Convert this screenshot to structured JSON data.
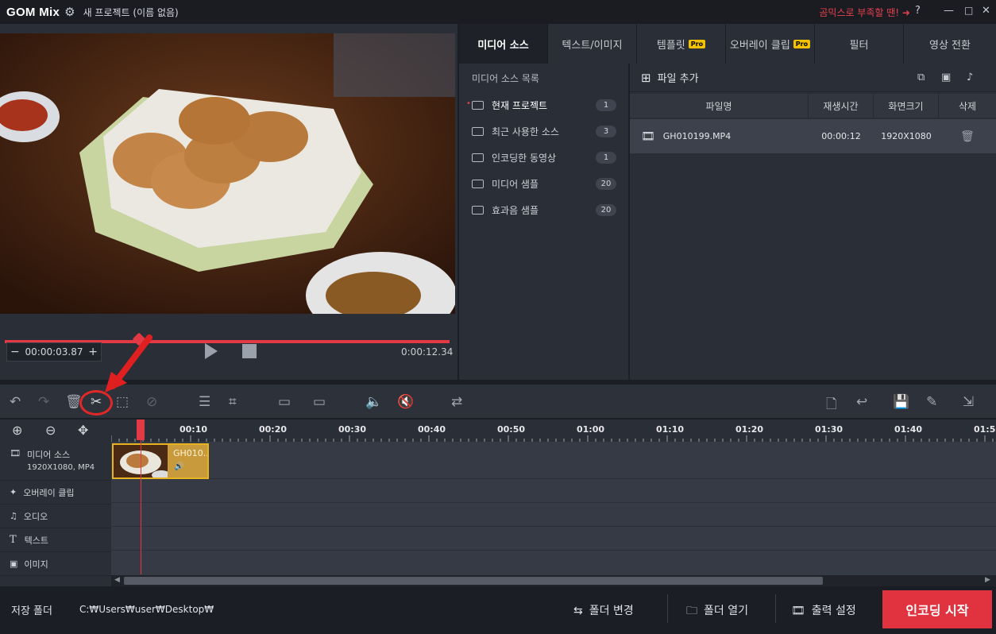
{
  "title": {
    "logo": "GOM Mix",
    "project": "새 프로젝트 (이름 없음)",
    "promo": "곰믹스로 부족할 땐! ➜",
    "help": "?",
    "minimize": "—",
    "maximize": "□",
    "close": "✕"
  },
  "player": {
    "current_time": "00:00:03.87",
    "duration": "0:00:12.34",
    "minus": "−",
    "plus": "+",
    "progress": 0.3
  },
  "tabs": [
    {
      "label": "미디어 소스",
      "pro": false
    },
    {
      "label": "텍스트/이미지",
      "pro": false
    },
    {
      "label": "템플릿",
      "pro": true
    },
    {
      "label": "오버레이 클립",
      "pro": true
    },
    {
      "label": "필터",
      "pro": false
    },
    {
      "label": "영상 전환",
      "pro": false
    }
  ],
  "pro_badge": "Pro",
  "source_list": {
    "header": "미디어 소스 목록",
    "items": [
      {
        "label": "현재 프로젝트",
        "count": "1"
      },
      {
        "label": "최근 사용한 소스",
        "count": "3"
      },
      {
        "label": "인코딩한 동영상",
        "count": "1"
      },
      {
        "label": "미디어 샘플",
        "count": "20"
      },
      {
        "label": "효과음 샘플",
        "count": "20"
      }
    ]
  },
  "files": {
    "add_label": "파일 추가",
    "columns": [
      "파일명",
      "재생시간",
      "화면크기",
      "삭제"
    ],
    "rows": [
      {
        "name": "GH010199.MP4",
        "duration": "00:00:12",
        "size": "1920X1080"
      }
    ]
  },
  "timeline": {
    "ticks": [
      "00:10",
      "00:20",
      "00:30",
      "00:40",
      "00:50",
      "01:00",
      "01:10",
      "01:20",
      "01:30",
      "01:40",
      "01:50"
    ],
    "tracks": [
      {
        "label": "미디어 소스",
        "sub": "1920X1080, MP4"
      },
      {
        "label": "오버레이 클립",
        "sub": ""
      },
      {
        "label": "오디오",
        "sub": ""
      },
      {
        "label": "텍스트",
        "sub": ""
      },
      {
        "label": "이미지",
        "sub": ""
      }
    ],
    "clip_label": "GH010..."
  },
  "bottom": {
    "save_folder_label": "저장 폴더",
    "save_path": "C:₩Users₩user₩Desktop₩",
    "change_folder": "폴더 변경",
    "open_folder": "폴더 열기",
    "output_settings": "출력 설정",
    "encode": "인코딩 시작"
  },
  "colors": {
    "accent": "#e0323f",
    "clip_border": "#e7b320",
    "pro_badge": "#f2c200"
  }
}
